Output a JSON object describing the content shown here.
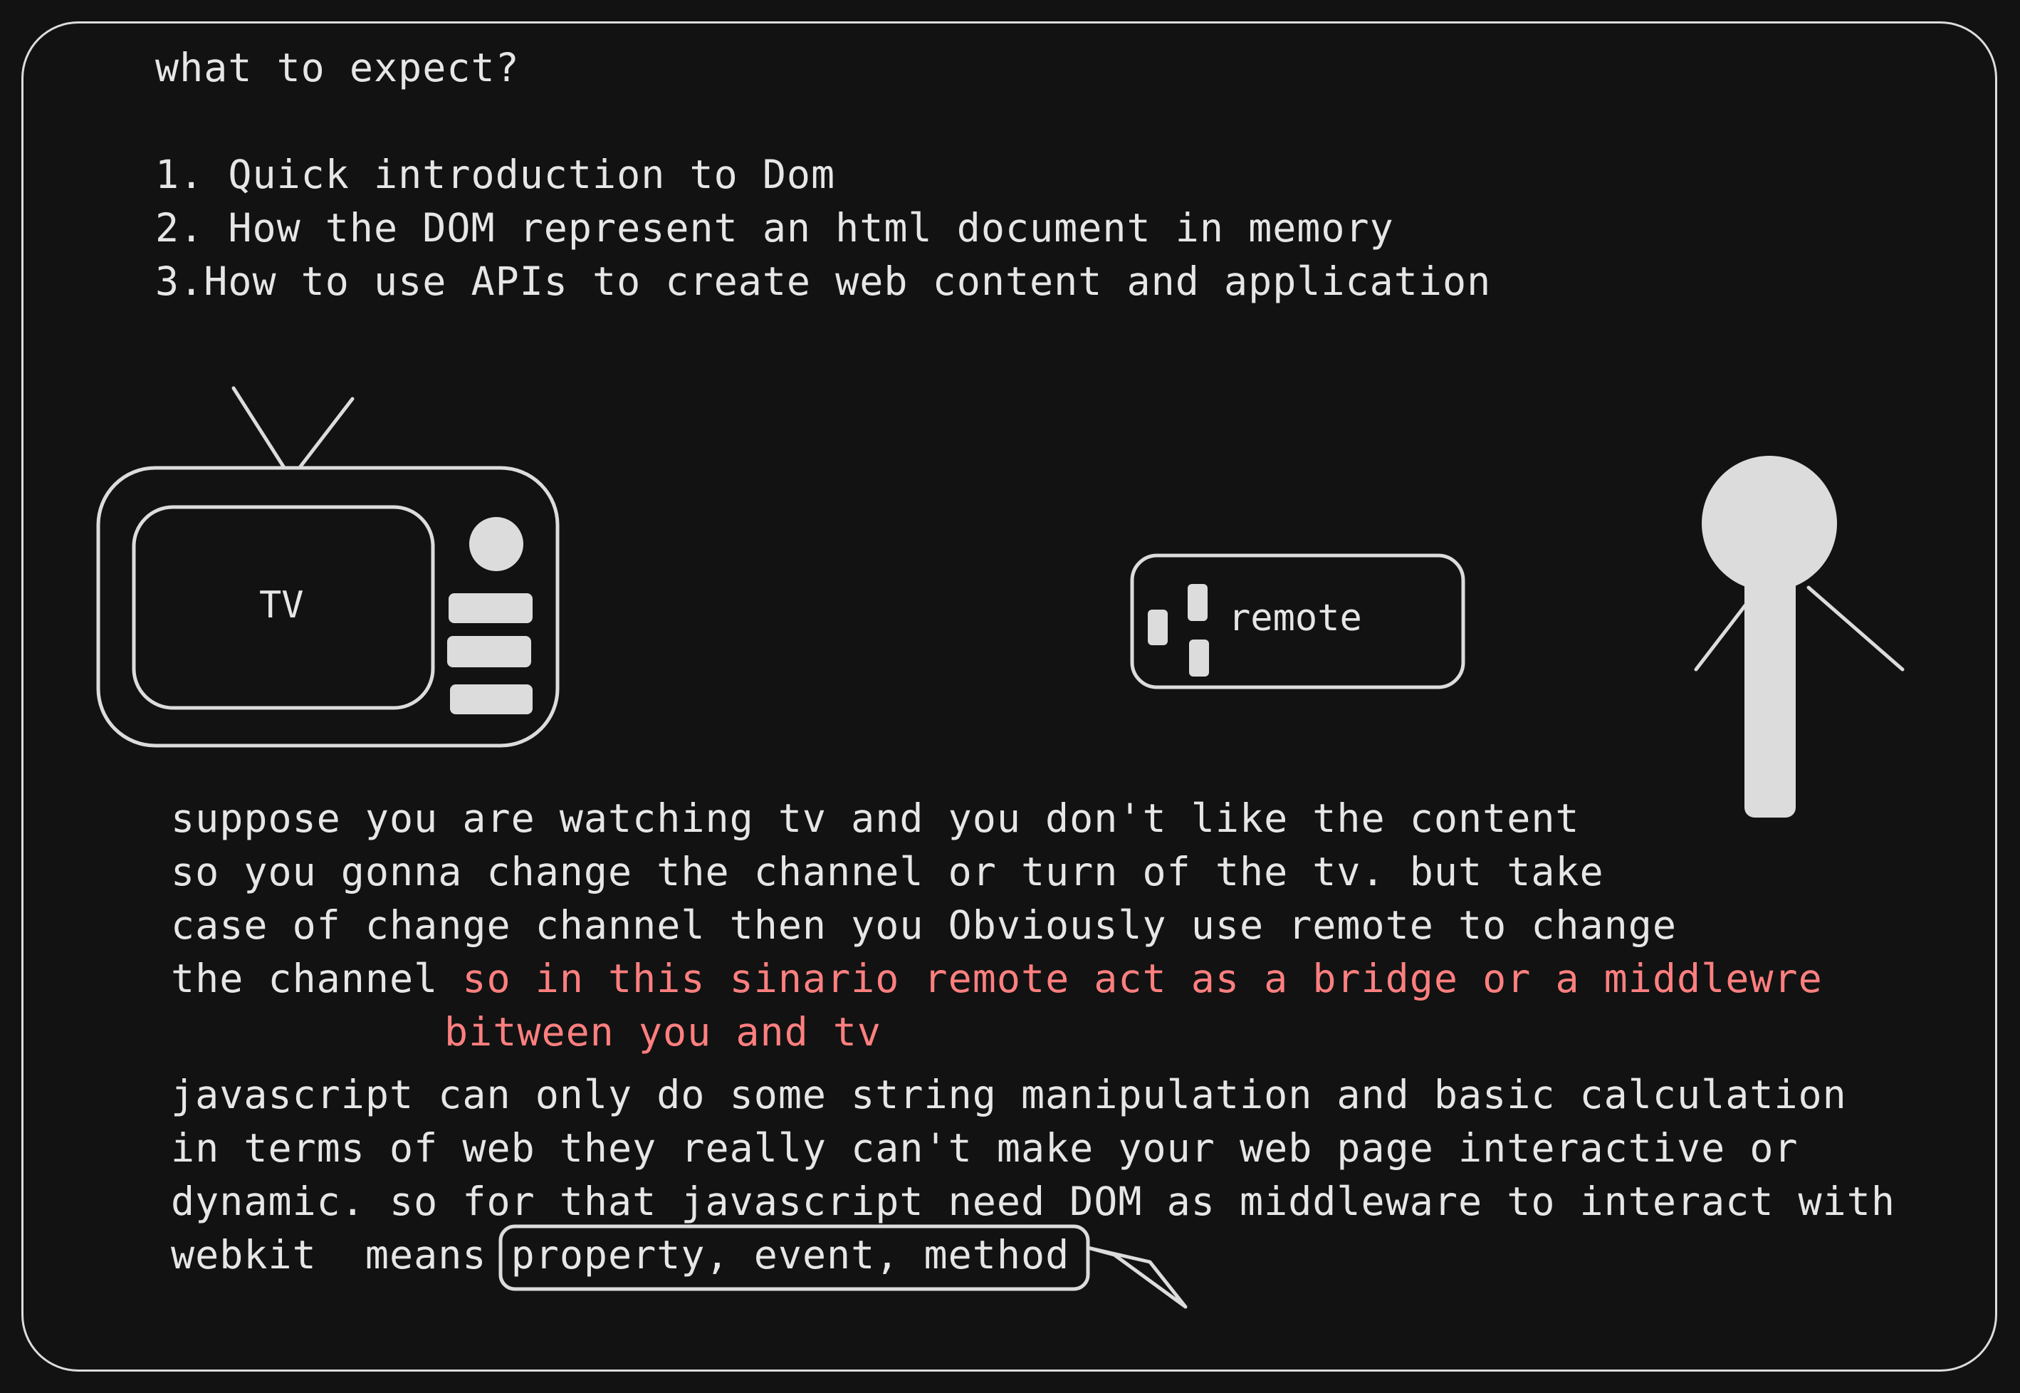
{
  "intro": {
    "heading": "what to expect?",
    "points": [
      "1. Quick introduction to Dom",
      "2. How the DOM represent an html document in memory",
      "3.How to use APIs to create web content and application"
    ]
  },
  "illustration": {
    "tv_label": "TV",
    "remote_label": "remote"
  },
  "story": {
    "lines": [
      "suppose you are watching tv and you don't like the content",
      "so you gonna change the channel or turn of the tv. but take",
      "case of change channel then you Obviously use remote to change"
    ],
    "last_line_prefix": "the channel",
    "highlight_line_1": "so in this sinario remote act as a bridge or a middlewre",
    "highlight_line_2": "bitween you and tv"
  },
  "javascript": {
    "lines": [
      "javascript can only do some string manipulation and basic calculation",
      "in terms of web they really can't make your web page interactive or",
      "dynamic. so for that javascript need DOM as middleware to interact with"
    ],
    "last_line_prefix": "webkit  means",
    "boxed_text": "property, event, method"
  },
  "colors": {
    "background": "#121212",
    "stroke": "#dcdcdc",
    "highlight": "#ff7f7f"
  }
}
